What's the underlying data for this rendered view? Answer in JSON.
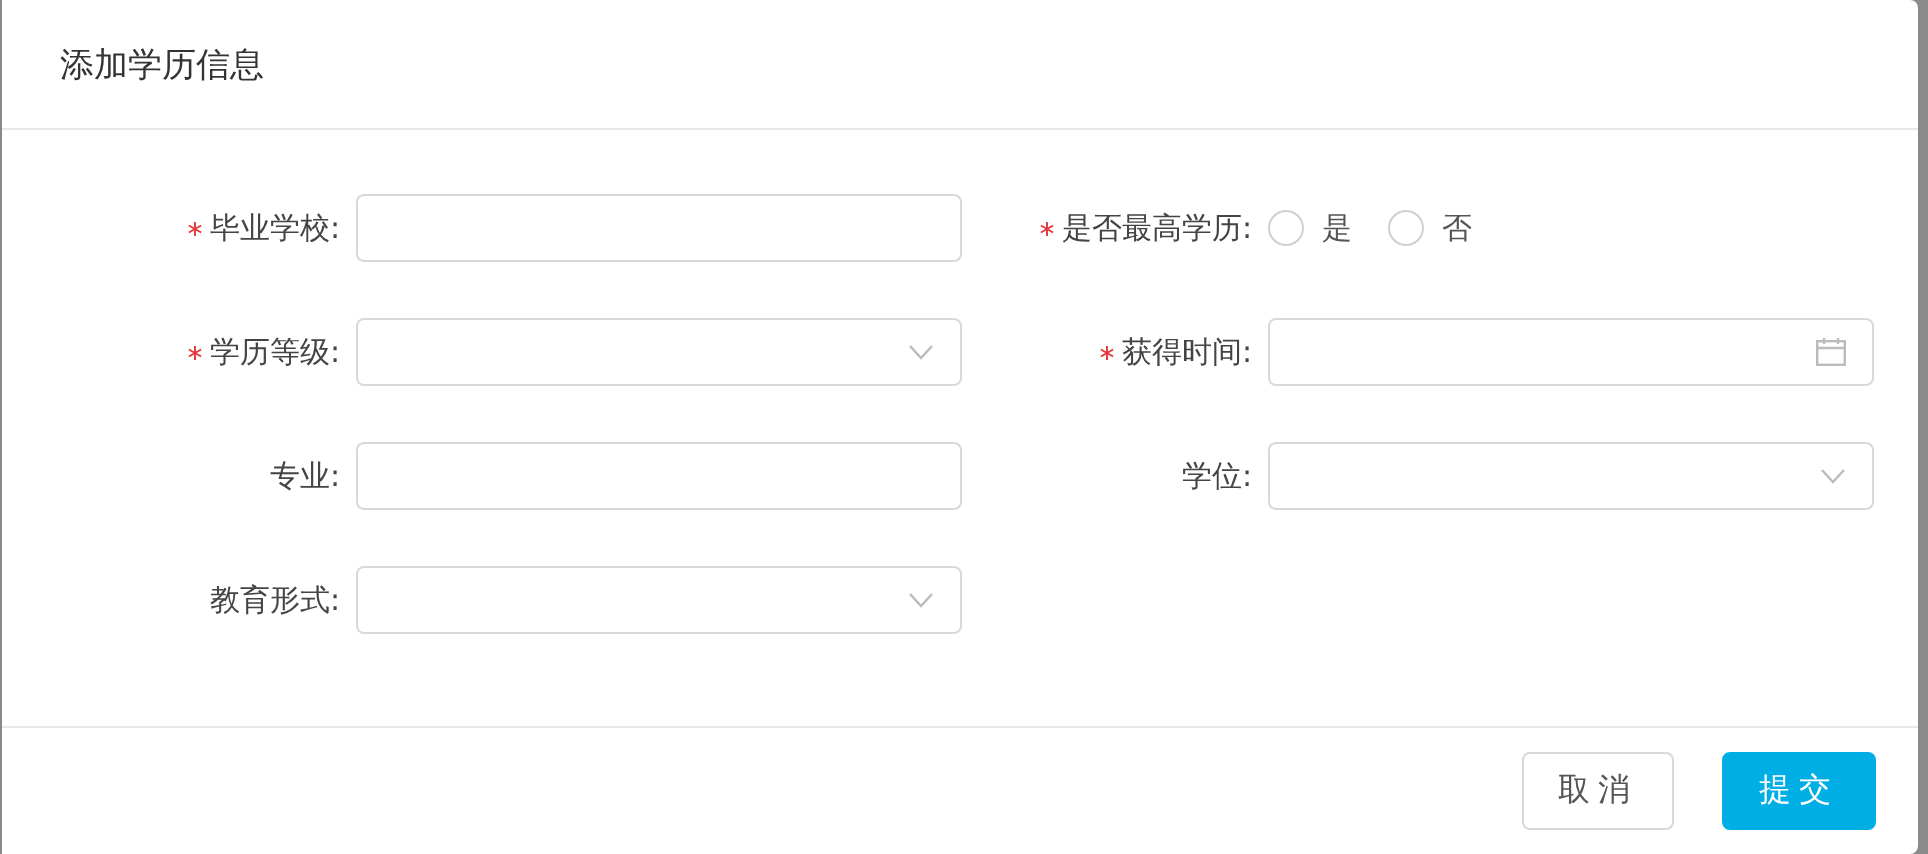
{
  "dialog": {
    "title": "添加学历信息"
  },
  "fields": [
    {
      "kind": "text",
      "label": "毕业学校:",
      "required": true
    },
    {
      "kind": "radio",
      "label": "是否最高学历:",
      "required": true,
      "options": [
        {
          "label": "是",
          "selected": false
        },
        {
          "label": "否",
          "selected": false
        }
      ]
    },
    {
      "kind": "select",
      "label": "学历等级:",
      "required": true
    },
    {
      "kind": "date",
      "label": "获得时间:",
      "required": true
    },
    {
      "kind": "text",
      "label": "专业:",
      "required": false
    },
    {
      "kind": "select",
      "label": "学位:",
      "required": false
    },
    {
      "kind": "select",
      "label": "教育形式:",
      "required": false
    }
  ],
  "buttons": [
    {
      "label": "取消",
      "kind": "default"
    },
    {
      "label": "提交",
      "kind": "primary"
    }
  ]
}
